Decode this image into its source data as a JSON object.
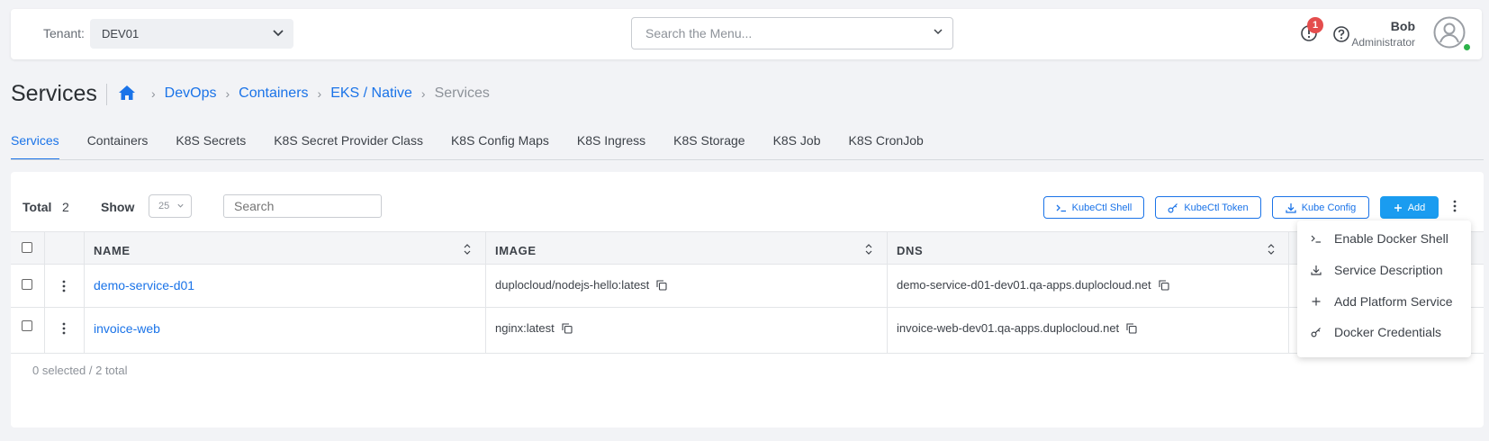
{
  "header": {
    "tenant_label": "Tenant:",
    "tenant_value": "DEV01",
    "menu_search_placeholder": "Search the Menu...",
    "notification_count": "1",
    "user_name": "Bob",
    "user_role": "Administrator",
    "colors": {
      "accent": "#1a73e8",
      "badge": "#e44d4d",
      "online": "#2cb34a"
    }
  },
  "page": {
    "title": "Services",
    "breadcrumb": [
      "DevOps",
      "Containers",
      "EKS / Native"
    ],
    "breadcrumb_current": "Services"
  },
  "tabs": [
    {
      "label": "Services",
      "active": true
    },
    {
      "label": "Containers"
    },
    {
      "label": "K8S Secrets"
    },
    {
      "label": "K8S Secret Provider Class"
    },
    {
      "label": "K8S Config Maps"
    },
    {
      "label": "K8S Ingress"
    },
    {
      "label": "K8S Storage"
    },
    {
      "label": "K8S Job"
    },
    {
      "label": "K8S CronJob"
    }
  ],
  "toolbar": {
    "total_label": "Total",
    "total_count": "2",
    "show_label": "Show",
    "page_size": "25",
    "search_placeholder": "Search",
    "kubectl_shell": "KubeCtl Shell",
    "kubectl_token": "KubeCtl Token",
    "kube_config": "Kube Config",
    "add": "Add"
  },
  "table": {
    "columns": [
      "NAME",
      "IMAGE",
      "DNS"
    ],
    "rows": [
      {
        "name": "demo-service-d01",
        "image": "duplocloud/nodejs-hello:latest",
        "dns": "demo-service-d01-dev01.qa-apps.duplocloud.net"
      },
      {
        "name": "invoice-web",
        "image": "nginx:latest",
        "dns": "invoice-web-dev01.qa-apps.duplocloud.net"
      }
    ],
    "footer": "0 selected / 2 total"
  },
  "dropdown_menu": [
    {
      "label": "Enable Docker Shell",
      "icon": "terminal-icon"
    },
    {
      "label": "Service Description",
      "icon": "download-icon"
    },
    {
      "label": "Add Platform Service",
      "icon": "plus-icon"
    },
    {
      "label": "Docker Credentials",
      "icon": "key-icon"
    }
  ]
}
